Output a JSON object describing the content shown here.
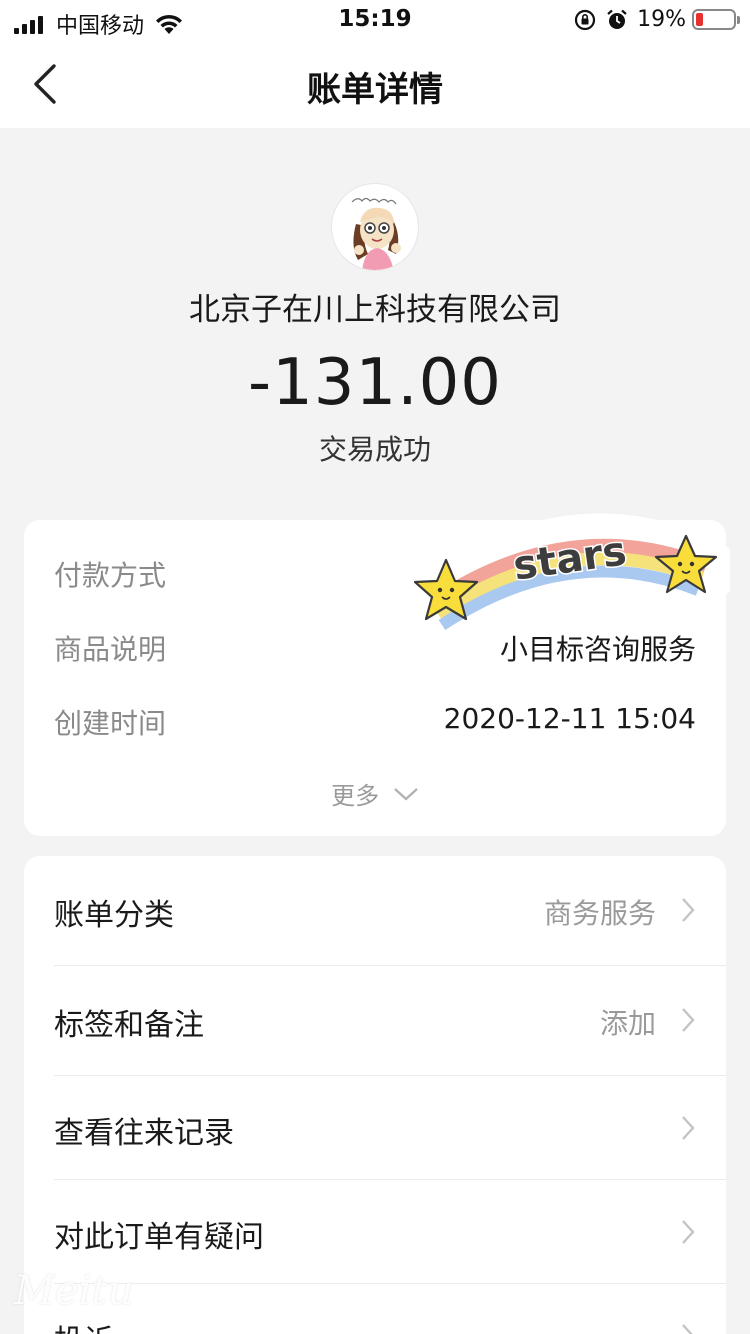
{
  "status_bar": {
    "carrier": "中国移动",
    "time": "15:19",
    "battery_percent": "19%",
    "battery_level": 0.19,
    "icons": [
      "signal-icon",
      "wifi-icon",
      "rotation-lock-icon",
      "alarm-icon",
      "battery-icon"
    ]
  },
  "nav": {
    "title": "账单详情",
    "back_icon": "chevron-left-icon"
  },
  "header": {
    "merchant": "北京子在川上科技有限公司",
    "amount": "-131.00",
    "status": "交易成功"
  },
  "details": {
    "rows": [
      {
        "key": "付款方式",
        "value": ""
      },
      {
        "key": "商品说明",
        "value": "小目标咨询服务"
      },
      {
        "key": "创建时间",
        "value": "2020-12-11 15:04"
      }
    ],
    "more_label": "更多"
  },
  "actions": {
    "items": [
      {
        "label": "账单分类",
        "value": "商务服务"
      },
      {
        "label": "标签和备注",
        "value": "添加"
      },
      {
        "label": "查看往来记录",
        "value": ""
      },
      {
        "label": "对此订单有疑问",
        "value": ""
      },
      {
        "label": "投诉",
        "value": ""
      }
    ]
  },
  "sticker": {
    "text": "stars",
    "colors": [
      "#f2a39a",
      "#f6e27a",
      "#a9c9f0"
    ]
  },
  "watermark": "Meitu"
}
